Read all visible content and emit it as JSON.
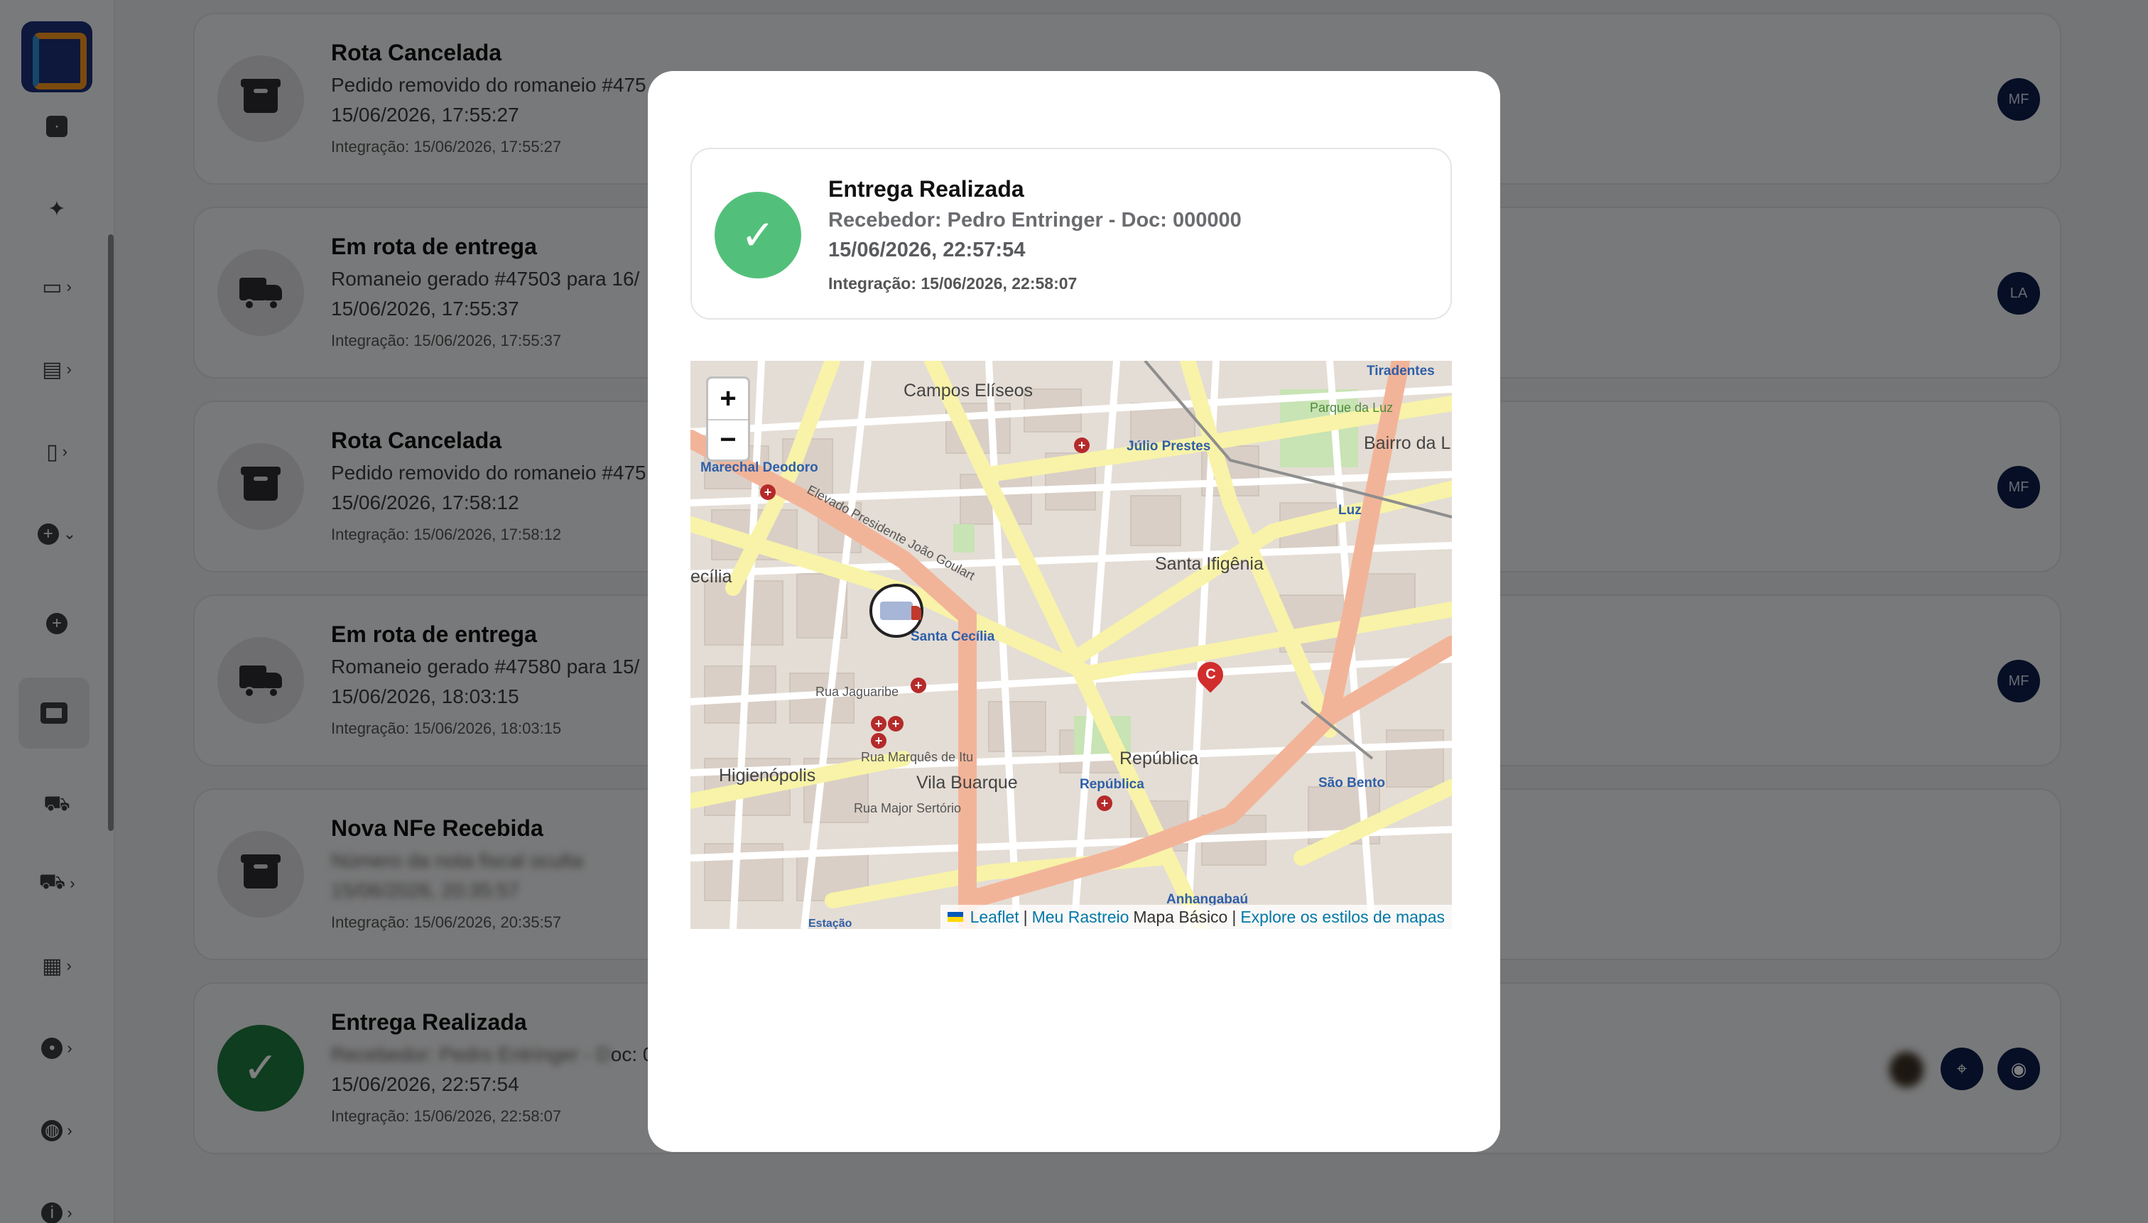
{
  "sidebar": {
    "items": [
      {
        "icon": "chat-icon"
      },
      {
        "icon": "magic-wand-icon"
      },
      {
        "icon": "truck-icon"
      },
      {
        "icon": "chart-icon"
      },
      {
        "icon": "phone-icon"
      },
      {
        "icon": "plus-circle-icon"
      },
      {
        "icon": "add-circle-icon"
      },
      {
        "icon": "box-icon"
      },
      {
        "icon": "delivery-truck-icon"
      },
      {
        "icon": "truck-small-icon"
      },
      {
        "icon": "building-icon"
      },
      {
        "icon": "circle-icon"
      },
      {
        "icon": "globe-icon"
      },
      {
        "icon": "info-icon"
      }
    ]
  },
  "timeline": {
    "cards": [
      {
        "title": "Rota Cancelada",
        "line1": "Pedido removido do romaneio #475",
        "line2": "15/06/2026, 17:55:27",
        "line3": "Integração: 15/06/2026, 17:55:27",
        "avatar": "MF"
      },
      {
        "title": "Em rota de entrega",
        "line1": "Romaneio gerado #47503 para 16/",
        "line2": "15/06/2026, 17:55:37",
        "line3": "Integração: 15/06/2026, 17:55:37",
        "avatar": "LA"
      },
      {
        "title": "Rota Cancelada",
        "line1": "Pedido removido do romaneio #475",
        "line2": "15/06/2026, 17:58:12",
        "line3": "Integração: 15/06/2026, 17:58:12",
        "avatar": "MF"
      },
      {
        "title": "Em rota de entrega",
        "line1": "Romaneio gerado #47580 para 15/",
        "line2": "15/06/2026, 18:03:15",
        "line3": "Integração: 15/06/2026, 18:03:15",
        "avatar": "MF"
      },
      {
        "title": "Nova NFe Recebida",
        "line1": "Número da nota fiscal oculta",
        "line2": "15/06/2026, 20:35:57",
        "line3": "Integração: 15/06/2026, 20:35:57"
      },
      {
        "title": "Entrega Realizada",
        "line1_blur": "Recebedor: Pedro Entringer - D",
        "line1_rest": "oc: 000000",
        "line2": "15/06/2026, 22:57:54",
        "line3": "Integração: 15/06/2026, 22:58:07"
      }
    ]
  },
  "modal": {
    "status": {
      "title": "Entrega Realizada",
      "receiver": "Recebedor: Pedro Entringer - Doc: 000000",
      "datetime": "15/06/2026, 22:57:54",
      "integration": "Integração: 15/06/2026, 22:58:07"
    },
    "map": {
      "zoom_in": "+",
      "zoom_out": "−",
      "labels": {
        "campos_eliseos": "Campos Elíseos",
        "julio_prestes": "Júlio Prestes",
        "tiradentes": "Tiradentes",
        "parque_da_luz": "Parque da Luz",
        "bairro_da_luz": "Bairro da L",
        "marechal_deodoro": "Marechal Deodoro",
        "santa_ifigenia": "Santa Ifigênia",
        "cecilia": "ecília",
        "santa_cecilia": "Santa Cecília",
        "higienopolis": "Higienópolis",
        "vila_buarque": "Vila Buarque",
        "republica": "República",
        "republica_station": "República",
        "sao_bento": "São Bento",
        "anhangabau": "Anhangabaú",
        "luz": "Luz",
        "elevado": "Elevado Presidente João Goulart",
        "rua_jaguaribe": "Rua Jaguaribe",
        "rua_marques_itu": "Rua Marquês de Itu",
        "rua_major_sertorio": "Rua Major Sertório",
        "estacao": "Estação"
      },
      "marker_letter": "C",
      "attribution": {
        "leaflet": "Leaflet",
        "separator": "|",
        "meu_rastreio": "Meu Rastreio",
        "mapa_basico": "Mapa Básico",
        "explore": "Explore os estilos de mapas"
      },
      "colors": {
        "major_road": "#f8f3a8",
        "primary_road": "#f2b499",
        "park": "#c8e3b4",
        "block": "#dcd4cc"
      }
    }
  },
  "colors": {
    "success_green": "#52c07b",
    "avatar_navy": "#0c1f4a"
  }
}
